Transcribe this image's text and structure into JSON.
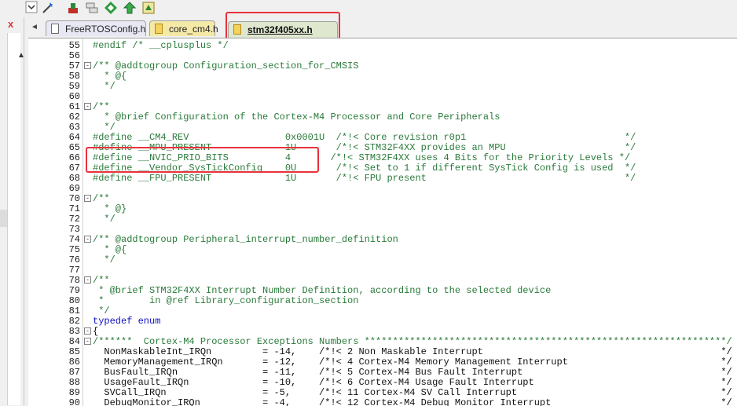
{
  "toolbar": {
    "icons": [
      "dropdown-arrow-icon",
      "magic-wand-icon",
      "configure-icon",
      "stack-icon",
      "green-diamond-icon",
      "green-arrow-icon",
      "manage-icon"
    ]
  },
  "left_panel": {
    "close": "x",
    "arrow": "▲"
  },
  "tabs": [
    {
      "label": "FreeRTOSConfig.h",
      "icon": "document-icon"
    },
    {
      "label": "core_cm4.h",
      "icon": "header-file-icon"
    },
    {
      "label": "stm32f405xx.h",
      "icon": "header-file-icon",
      "active": true
    }
  ],
  "tab_scroll": "◄",
  "code_lines": [
    {
      "n": "55",
      "fold": "",
      "text": "#endif /* __cplusplus */"
    },
    {
      "n": "56",
      "fold": "",
      "text": ""
    },
    {
      "n": "57",
      "fold": "-",
      "text": "/** @addtogroup Configuration_section_for_CMSIS"
    },
    {
      "n": "58",
      "fold": "",
      "text": "  * @{"
    },
    {
      "n": "59",
      "fold": "",
      "text": "  */"
    },
    {
      "n": "60",
      "fold": "",
      "text": ""
    },
    {
      "n": "61",
      "fold": "-",
      "text": "/**"
    },
    {
      "n": "62",
      "fold": "",
      "text": "  * @brief Configuration of the Cortex-M4 Processor and Core Peripherals"
    },
    {
      "n": "63",
      "fold": "",
      "text": "  */"
    },
    {
      "n": "64",
      "fold": "",
      "text": "#define __CM4_REV                 0x0001U  /*!< Core revision r0p1                            */"
    },
    {
      "n": "65",
      "fold": "",
      "text": "#define __MPU_PRESENT             1U       /*!< STM32F4XX provides an MPU                     */"
    },
    {
      "n": "66",
      "fold": "",
      "text": "#define __NVIC_PRIO_BITS          4       /*!< STM32F4XX uses 4 Bits for the Priority Levels */"
    },
    {
      "n": "67",
      "fold": "",
      "text": "#define __Vendor_SysTickConfig    0U       /*!< Set to 1 if different SysTick Config is used  */"
    },
    {
      "n": "68",
      "fold": "",
      "text": "#define __FPU_PRESENT             1U       /*!< FPU present                                   */"
    },
    {
      "n": "69",
      "fold": "",
      "text": ""
    },
    {
      "n": "70",
      "fold": "-",
      "text": "/**"
    },
    {
      "n": "71",
      "fold": "",
      "text": "  * @}"
    },
    {
      "n": "72",
      "fold": "",
      "text": "  */"
    },
    {
      "n": "73",
      "fold": "",
      "text": ""
    },
    {
      "n": "74",
      "fold": "-",
      "text": "/** @addtogroup Peripheral_interrupt_number_definition"
    },
    {
      "n": "75",
      "fold": "",
      "text": "  * @{"
    },
    {
      "n": "76",
      "fold": "",
      "text": "  */"
    },
    {
      "n": "77",
      "fold": "",
      "text": ""
    },
    {
      "n": "78",
      "fold": "-",
      "text": "/**"
    },
    {
      "n": "79",
      "fold": "",
      "text": " * @brief STM32F4XX Interrupt Number Definition, according to the selected device"
    },
    {
      "n": "80",
      "fold": "",
      "text": " *        in @ref Library_configuration_section"
    },
    {
      "n": "81",
      "fold": "",
      "text": " */"
    },
    {
      "n": "82",
      "fold": "",
      "text": "typedef enum"
    },
    {
      "n": "83",
      "fold": "-",
      "text": "{"
    },
    {
      "n": "84",
      "fold": "-",
      "text": "/******  Cortex-M4 Processor Exceptions Numbers ****************************************************************/"
    },
    {
      "n": "85",
      "fold": "",
      "text": "  NonMaskableInt_IRQn         = -14,    /*!< 2 Non Maskable Interrupt                                          */"
    },
    {
      "n": "86",
      "fold": "",
      "text": "  MemoryManagement_IRQn       = -12,    /*!< 4 Cortex-M4 Memory Management Interrupt                           */"
    },
    {
      "n": "87",
      "fold": "",
      "text": "  BusFault_IRQn               = -11,    /*!< 5 Cortex-M4 Bus Fault Interrupt                                   */"
    },
    {
      "n": "88",
      "fold": "",
      "text": "  UsageFault_IRQn             = -10,    /*!< 6 Cortex-M4 Usage Fault Interrupt                                 */"
    },
    {
      "n": "89",
      "fold": "",
      "text": "  SVCall_IRQn                 = -5,     /*!< 11 Cortex-M4 SV Call Interrupt                                    */"
    },
    {
      "n": "90",
      "fold": "",
      "text": "  DebugMonitor_IRQn           = -4,     /*!< 12 Cortex-M4 Debug Monitor Interrupt                              */"
    }
  ]
}
